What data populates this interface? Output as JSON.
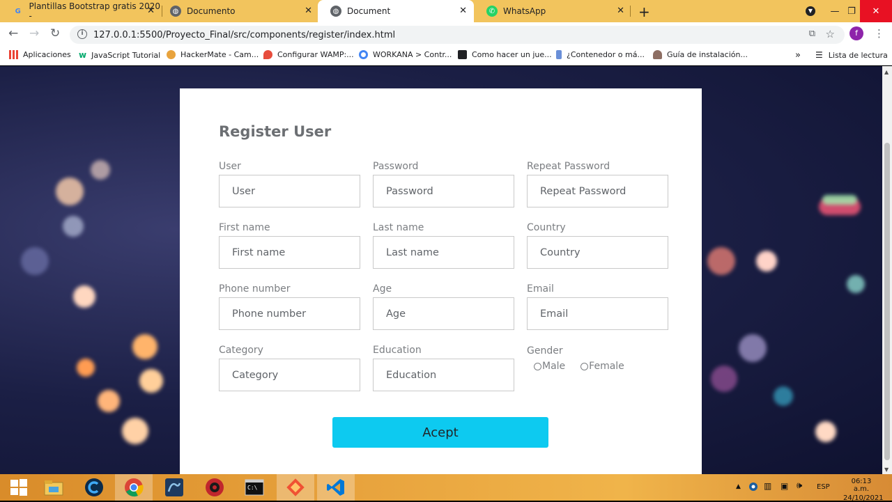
{
  "browser": {
    "tabs": [
      {
        "title": "Plantillas Bootstrap gratis 2020 -",
        "icon": "google-icon",
        "active": false
      },
      {
        "title": "Documento",
        "icon": "globe-icon",
        "active": false
      },
      {
        "title": "Document",
        "icon": "globe-icon",
        "active": true
      },
      {
        "title": "WhatsApp",
        "icon": "whatsapp-icon",
        "active": false
      }
    ],
    "url": "127.0.0.1:5500/Proyecto_Final/src/components/register/index.html",
    "profile_initial": "f",
    "bookmarks": [
      {
        "label": "Aplicaciones",
        "icon": "apps-grid-icon"
      },
      {
        "label": "JavaScript Tutorial",
        "icon": "w3schools-icon"
      },
      {
        "label": "HackerMate - Cam...",
        "icon": "hackermate-icon"
      },
      {
        "label": "Configurar WAMP:...",
        "icon": "pin-icon"
      },
      {
        "label": "WORKANA > Contr...",
        "icon": "workana-icon"
      },
      {
        "label": "Como hacer un jue...",
        "icon": "site-icon"
      },
      {
        "label": "¿Contenedor o má...",
        "icon": "arrow-icon"
      },
      {
        "label": "Guía de instalación...",
        "icon": "person-icon"
      }
    ],
    "bookmarks_overflow": "»",
    "reading_list": "Lista de lectura"
  },
  "form": {
    "title": "Register User",
    "fields": [
      {
        "label": "User",
        "placeholder": "User"
      },
      {
        "label": "Password",
        "placeholder": "Password"
      },
      {
        "label": "Repeat Password",
        "placeholder": "Repeat Password"
      },
      {
        "label": "First name",
        "placeholder": "First name"
      },
      {
        "label": "Last name",
        "placeholder": "Last name"
      },
      {
        "label": "Country",
        "placeholder": "Country"
      },
      {
        "label": "Phone number",
        "placeholder": "Phone number"
      },
      {
        "label": "Age",
        "placeholder": "Age"
      },
      {
        "label": "Email",
        "placeholder": "Email"
      },
      {
        "label": "Category",
        "placeholder": "Category"
      },
      {
        "label": "Education",
        "placeholder": "Education"
      }
    ],
    "gender": {
      "label": "Gender",
      "options": [
        "Male",
        "Female"
      ]
    },
    "submit_label": "Acept",
    "accent_color": "#0dcaf0"
  },
  "taskbar": {
    "apps": [
      "windows-start-icon",
      "file-explorer-icon",
      "ccleaner-icon",
      "chrome-icon",
      "mysql-workbench-icon",
      "davinci-icon",
      "terminal-icon",
      "git-icon",
      "vscode-icon"
    ],
    "language": "ESP",
    "time": "06:13 a.m.",
    "date": "24/10/2021"
  }
}
